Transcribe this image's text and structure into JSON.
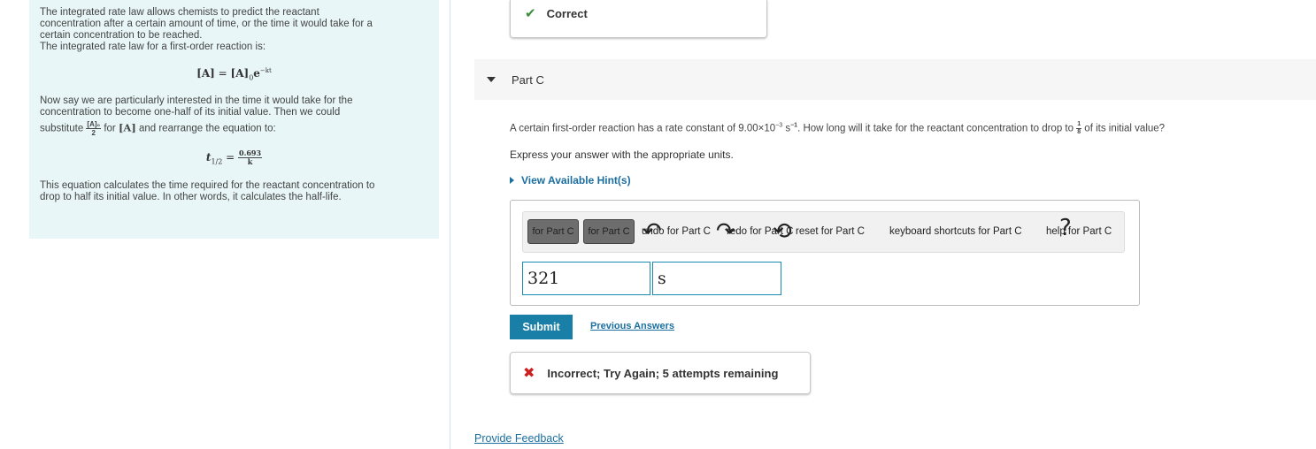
{
  "info": {
    "p1_line1": "The integrated rate law allows chemists to predict the reactant",
    "p1_line2": "concentration after a certain amount of time, or the time it would take for a",
    "p1_line3": "certain concentration to be reached.",
    "p1_line4": "The integrated rate law for a first-order reaction is:",
    "eq1_lhs": "[A]",
    "eq1_eq": " = ",
    "eq1_rhs": "[A]",
    "eq1_sub": "0",
    "eq1_e": "e",
    "eq1_exp": "−kt",
    "p2_line1": "Now say we are particularly interested in the time it would take for the",
    "p2_line2": "concentration to become one-half of its initial value. Then we could",
    "p2_sub_word": "substitute ",
    "p2_frac_num": "[A]₀",
    "p2_frac_den": "2",
    "p2_for": " for ",
    "p2_var": "[A]",
    "p2_rest": " and rearrange the equation to:",
    "eq2_lhs": "t",
    "eq2_sub": "1/2",
    "eq2_eq": " = ",
    "eq2_num": "0.693",
    "eq2_den": "k",
    "p3_line1": "This equation calculates the time required for the reactant concentration to",
    "p3_line2": "drop to half its initial value. In other words, it calculates the half-life."
  },
  "feedback_top": {
    "text": "Correct"
  },
  "part": {
    "label": "Part C"
  },
  "question": {
    "before": "A certain first-order reaction has a rate constant of 9.00×10",
    "exp1": "−3",
    "unit": " s",
    "exp2": "−1",
    "mid": ". How long will it take for the reactant concentration to drop to ",
    "frac_num": "1",
    "frac_den": "8",
    "after": " of its initial value?"
  },
  "express": "Express your answer with the appropriate units.",
  "hint": "View Available Hint(s)",
  "toolbar": {
    "btn1": "for Part C",
    "btn2": "for Part C",
    "undo": "undo for Part C",
    "redo": "redo for Part C",
    "reset": "reset for Part C",
    "shortcuts": "keyboard shortcuts for Part C",
    "help": "help for Part C"
  },
  "answer": {
    "value": "321",
    "units": "s"
  },
  "submit": "Submit",
  "previous_answers": "Previous Answers",
  "feedback_bottom": {
    "text": "Incorrect; Try Again; 5 attempts remaining"
  },
  "provide_feedback": "Provide Feedback",
  "colors": {
    "panel_bg": "#e8f6f7",
    "accent": "#1a7fa6",
    "correct": "#3a8e3a",
    "incorrect": "#cc1f1f"
  }
}
